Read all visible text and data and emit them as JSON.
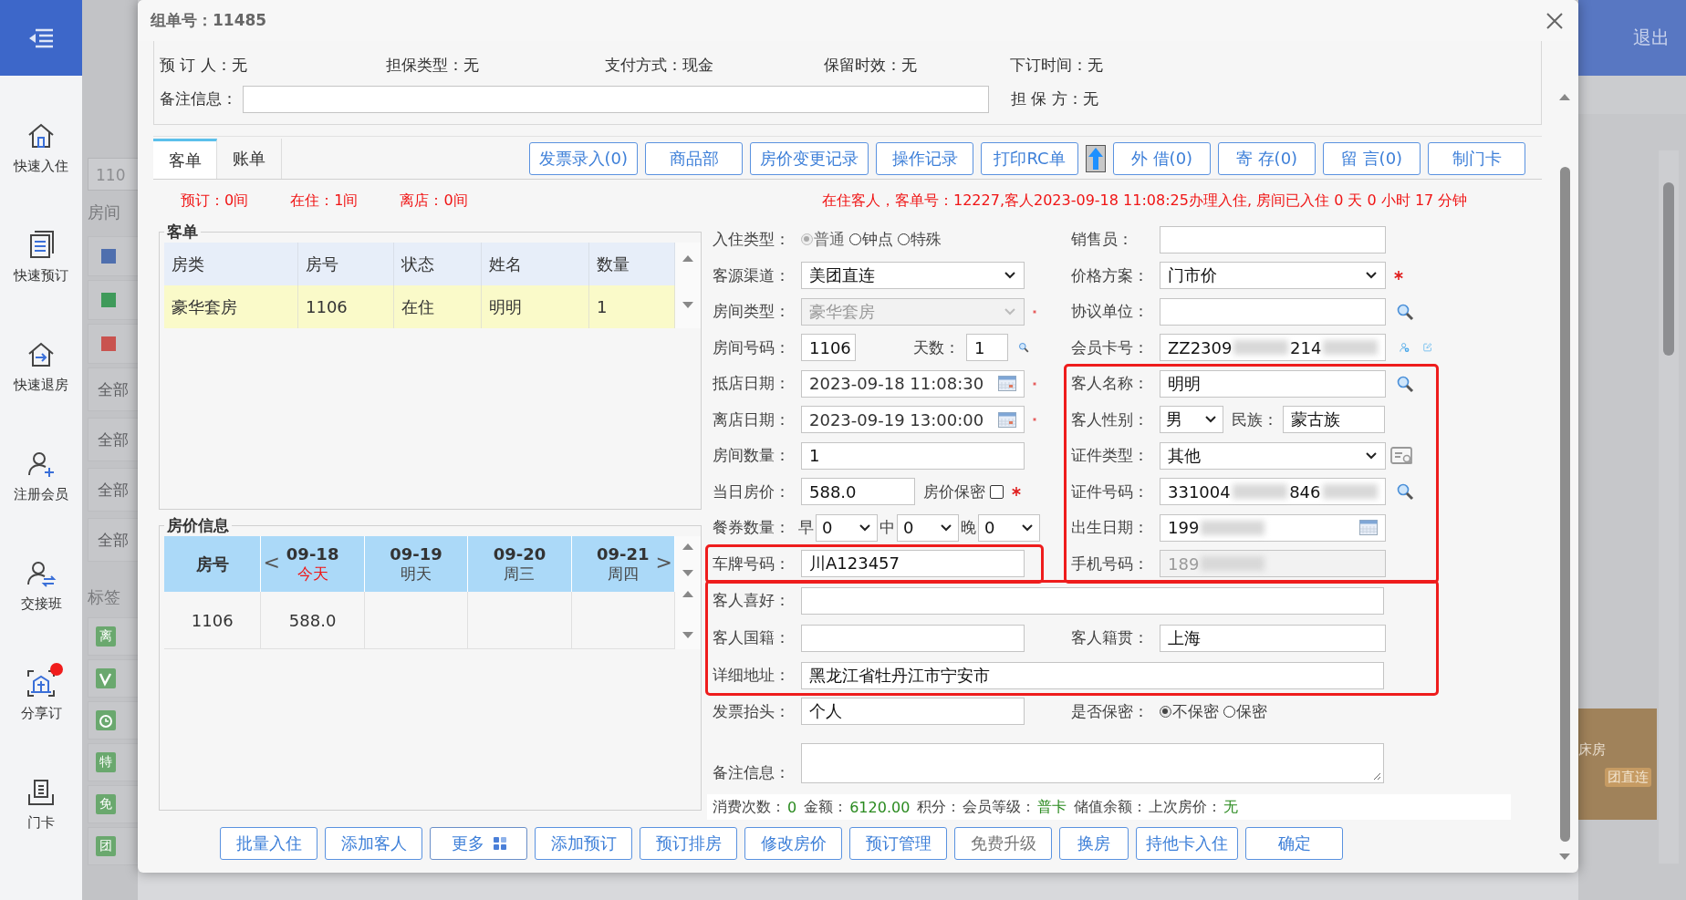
{
  "sidebar": {
    "items": [
      {
        "label": "快速入住",
        "kind": "home",
        "notify": false
      },
      {
        "label": "快速预订",
        "kind": "list",
        "notify": false
      },
      {
        "label": "快速退房",
        "kind": "checkout",
        "notify": false
      },
      {
        "label": "注册会员",
        "kind": "register",
        "notify": false
      },
      {
        "label": "交接班",
        "kind": "shift",
        "notify": false
      },
      {
        "label": "分享订",
        "kind": "share",
        "notify": true
      },
      {
        "label": "门卡",
        "kind": "card",
        "notify": false
      }
    ]
  },
  "background": {
    "search_value": "110",
    "rooms_label": "房间",
    "legend": [
      {
        "color": "#4f6fae"
      },
      {
        "color": "#3f9a5a"
      },
      {
        "color": "#c9534f"
      }
    ],
    "filters": [
      "全部",
      "全部",
      "全部",
      "全部"
    ],
    "tags_label": "标签",
    "tags": [
      {
        "kind": "text",
        "text": "离"
      },
      {
        "kind": "vip"
      },
      {
        "kind": "clock"
      },
      {
        "kind": "text",
        "text": "特"
      },
      {
        "kind": "text",
        "text": "免"
      },
      {
        "kind": "text",
        "text": "团"
      }
    ],
    "logout": "退出",
    "room_card": {
      "type": "床房",
      "channel": "团直连"
    }
  },
  "dialog": {
    "title": "组单号：11485",
    "booking": [
      {
        "label": "预 订 人：",
        "value": "无"
      },
      {
        "label": "担保类型：",
        "value": "无"
      },
      {
        "label": "支付方式：",
        "value": "现金"
      },
      {
        "label": "保留时效：",
        "value": "无"
      },
      {
        "label": "下订时间：",
        "value": "无"
      }
    ],
    "remark_label": "备注信息：",
    "guarantor": {
      "label": "担 保 方：",
      "value": "无"
    },
    "tabs": [
      {
        "label": "客单",
        "selected": true
      },
      {
        "label": "账单",
        "selected": false
      }
    ],
    "actions": [
      {
        "kind": "button",
        "label": "发票录入(0)"
      },
      {
        "kind": "button",
        "label": "商品部"
      },
      {
        "kind": "button",
        "label": "房价变更记录"
      },
      {
        "kind": "button",
        "label": "操作记录"
      },
      {
        "kind": "button",
        "label": "打印RC单"
      },
      {
        "kind": "upload"
      },
      {
        "kind": "button",
        "label": "外 借(0)"
      },
      {
        "kind": "button",
        "label": "寄 存(0)"
      },
      {
        "kind": "button",
        "label": "留 言(0)"
      },
      {
        "kind": "button",
        "label": "制门卡"
      }
    ],
    "counts": [
      "预订：0间",
      "在住：1间",
      "离店：0间"
    ],
    "notice": "在住客人，客单号：12227,客人2023-09-18 11:08:25办理入住, 房间已入住 0 天 0 小时 17 分钟",
    "guest_list": {
      "title": "客单",
      "columns": [
        "房类",
        "房号",
        "状态",
        "姓名",
        "数量"
      ],
      "rows": [
        {
          "cells": [
            "豪华套房",
            "1106",
            "在住",
            "明明",
            "1"
          ],
          "selected": true
        }
      ]
    },
    "rates": {
      "title": "房价信息",
      "room_header": "房号",
      "prev": "<",
      "next": ">",
      "dates": [
        {
          "date": "09-18",
          "day": "今天",
          "today": true
        },
        {
          "date": "09-19",
          "day": "明天",
          "today": false
        },
        {
          "date": "09-20",
          "day": "周三",
          "today": false
        },
        {
          "date": "09-21",
          "day": "周四",
          "today": false
        }
      ],
      "rows": [
        {
          "room": "1106",
          "prices": [
            "588.0"
          ]
        }
      ]
    },
    "form": {
      "left": [
        {
          "fields": [
            {
              "kind": "radio",
              "label": "入住类型：",
              "options": [
                {
                  "label": "普通",
                  "selected": true,
                  "disabled": true
                },
                {
                  "label": "钟点",
                  "selected": false,
                  "disabled": false
                },
                {
                  "label": "特殊",
                  "selected": false,
                  "disabled": false
                }
              ]
            },
            {
              "kind": "select",
              "label": "客源渠道：",
              "value": "美团直连"
            },
            {
              "kind": "select",
              "label": "房间类型：",
              "value": "豪华套房",
              "disabled": true,
              "required": true
            },
            {
              "kind": "room",
              "label": "房间号码：",
              "value": "1106",
              "search": true,
              "days_label": "天数：",
              "days": "1"
            },
            {
              "kind": "date",
              "label": "抵店日期：",
              "value": "2023-09-18 11:08:30",
              "required": true
            },
            {
              "kind": "date",
              "label": "离店日期：",
              "value": "2023-09-19 13:00:00",
              "required": true
            },
            {
              "kind": "input",
              "label": "房间数量：",
              "value": "1"
            },
            {
              "kind": "price",
              "label": "当日房价：",
              "value": "588.0",
              "required": true,
              "secret_label": "房价保密",
              "secret": false
            },
            {
              "kind": "meal",
              "label": "餐券数量：",
              "meals": [
                {
                  "label": "早",
                  "value": "0"
                },
                {
                  "label": "中",
                  "value": "0"
                },
                {
                  "label": "晚",
                  "value": "0"
                }
              ]
            }
          ]
        },
        {
          "highlight": true,
          "fields": [
            {
              "kind": "input",
              "label": "车牌号码：",
              "value": "川A123457"
            }
          ]
        }
      ],
      "right": [
        {
          "fields": [
            {
              "kind": "input",
              "label": "销售员："
            },
            {
              "kind": "select",
              "label": "价格方案：",
              "value": "门市价",
              "required": true
            },
            {
              "kind": "input",
              "label": "协议单位：",
              "search": true
            },
            {
              "kind": "masked",
              "label": "会员卡号：",
              "parts": [
                "ZZ2309",
                "214"
              ],
              "member_tools": true
            }
          ]
        },
        {
          "highlight": true,
          "fields": [
            {
              "kind": "input",
              "label": "客人名称：",
              "value": "明明",
              "search": true
            },
            {
              "kind": "gender",
              "label": "客人性别：",
              "value": "男",
              "ethnic_label": "民族：",
              "ethnic": "蒙古族"
            },
            {
              "kind": "select",
              "label": "证件类型：",
              "value": "其他",
              "id_reader": true
            },
            {
              "kind": "masked",
              "label": "证件号码：",
              "parts": [
                "331004",
                "846"
              ],
              "search": true
            },
            {
              "kind": "masked",
              "label": "出生日期：",
              "parts": [
                "199"
              ],
              "calendar": true
            },
            {
              "kind": "masked",
              "label": "手机号码：",
              "parts": [
                "189"
              ],
              "disabled": true
            }
          ]
        }
      ],
      "lower": [
        {
          "highlight": true,
          "rows": [
            [
              {
                "kind": "input",
                "label": "客人喜好："
              }
            ],
            [
              {
                "kind": "input",
                "label": "客人国籍："
              },
              {
                "kind": "input",
                "label": "客人籍贯：",
                "value": "上海"
              }
            ],
            [
              {
                "kind": "input",
                "label": "详细地址：",
                "value": "黑龙江省牡丹江市宁安市"
              }
            ]
          ]
        },
        {
          "rows": [
            [
              {
                "kind": "input",
                "label": "发票抬头：",
                "value": "个人"
              },
              {
                "kind": "radio",
                "label": "是否保密：",
                "options": [
                  {
                    "label": "不保密",
                    "selected": true,
                    "disabled": false
                  },
                  {
                    "label": "保密",
                    "selected": false,
                    "disabled": false
                  }
                ]
              }
            ],
            [
              {
                "kind": "textarea",
                "label": "备注信息："
              }
            ]
          ]
        }
      ]
    },
    "stats": [
      {
        "label": "消费次数：",
        "value": "0"
      },
      {
        "label": "金额：",
        "value": "6120.00"
      },
      {
        "label": "积分："
      },
      {
        "label": "会员等级：",
        "value": "普卡"
      },
      {
        "label": "储值余额："
      },
      {
        "label": "上次房价：",
        "value": "无"
      }
    ],
    "buttons": [
      {
        "label": "批量入住",
        "kind": "plain",
        "disabled": false
      },
      {
        "label": "添加客人",
        "kind": "plain",
        "disabled": false
      },
      {
        "label": "更多",
        "kind": "menu",
        "disabled": false
      },
      {
        "label": "添加预订",
        "kind": "plain",
        "disabled": false
      },
      {
        "label": "预订排房",
        "kind": "plain",
        "disabled": false
      },
      {
        "label": "修改房价",
        "kind": "plain",
        "disabled": false
      },
      {
        "label": "预订管理",
        "kind": "plain",
        "disabled": false
      },
      {
        "label": "免费升级",
        "kind": "plain",
        "disabled": true
      },
      {
        "label": "换房",
        "kind": "plain",
        "disabled": false
      },
      {
        "label": "持他卡入住",
        "kind": "plain",
        "disabled": false
      },
      {
        "label": "确定",
        "kind": "plain",
        "disabled": false
      }
    ]
  }
}
